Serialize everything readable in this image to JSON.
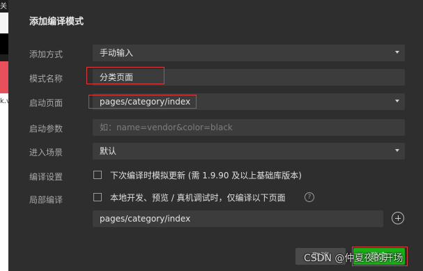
{
  "background_app": {
    "top_char": "关",
    "side_text": "k.v"
  },
  "dialog": {
    "title": "添加编译模式",
    "rows": {
      "add_method": {
        "label": "添加方式",
        "value": "手动输入"
      },
      "mode_name": {
        "label": "模式名称",
        "value": "分类页面"
      },
      "start_page": {
        "label": "启动页面",
        "value": "pages/category/index"
      },
      "start_params": {
        "label": "启动参数",
        "placeholder": "如：name=vendor&color=black"
      },
      "scene": {
        "label": "进入场景",
        "value": "默认"
      },
      "compile_settings": {
        "label": "编译设置",
        "checkbox_text": "下次编译时模拟更新 (需 1.9.90 及以上基础库版本)",
        "checked": false
      },
      "partial_compile": {
        "label": "局部编译",
        "checkbox_text": "本地开发、预览 / 真机调试时，仅编译以下页面",
        "checked": false,
        "help_icon": "?"
      }
    },
    "partial_page": "pages/category/index",
    "buttons": {
      "cancel": "取消",
      "ok": "确定"
    }
  },
  "watermark": "CSDN @仲夏夜的开场",
  "colors": {
    "ok_button": "#1aad19",
    "highlight_box": "#e03b3b"
  }
}
